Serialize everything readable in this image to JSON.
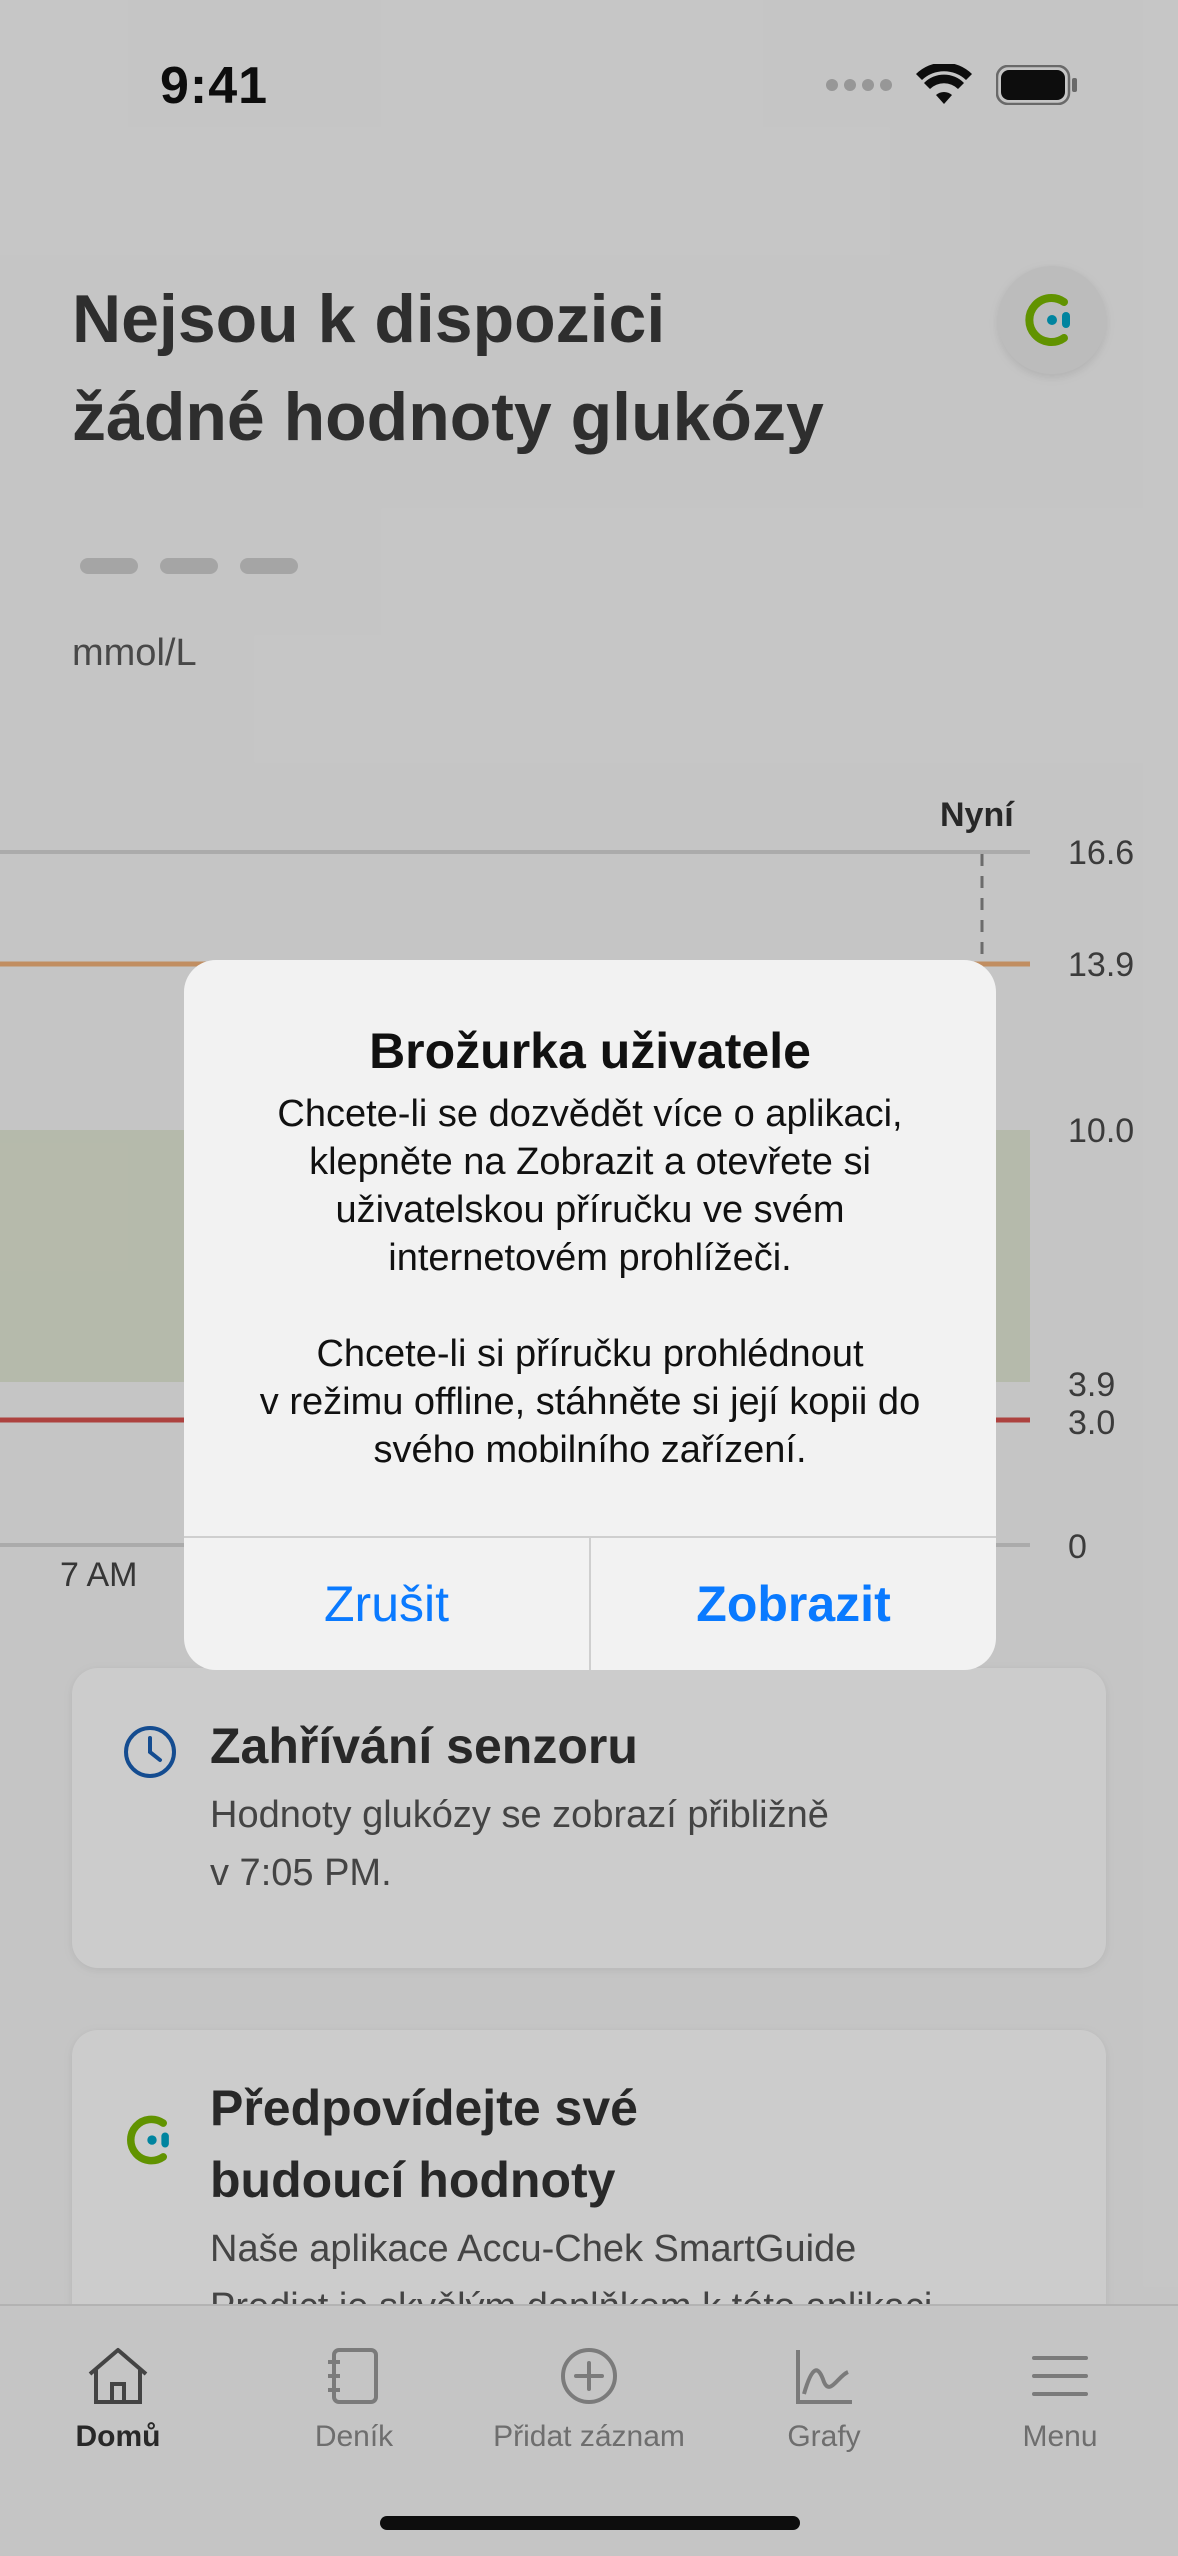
{
  "status_bar": {
    "time": "9:41"
  },
  "header": {
    "title_line1": "Nejsou k dispozici",
    "title_line2": "žádné hodnoty glukózy",
    "unit": "mmol/L"
  },
  "chart": {
    "now_label": "Nyní",
    "time_label": "7 AM",
    "y_ticks": [
      "16.6",
      "13.9",
      "10.0",
      "3.9",
      "3.0",
      "0"
    ]
  },
  "chart_data": {
    "type": "line",
    "ylabel": "mmol/L",
    "y_ticks": [
      16.6,
      13.9,
      10.0,
      3.9,
      3.0,
      0
    ],
    "target_range": [
      3.9,
      10.0
    ],
    "high_threshold": 13.9,
    "low_threshold": 3.0,
    "x_ticks": [
      "7 AM"
    ],
    "now_marker": "Nyní",
    "series": []
  },
  "cards": [
    {
      "title": "Zahřívání senzoru",
      "text_line1": "Hodnoty glukózy se zobrazí přibližně",
      "text_line2": "v 7:05 PM.",
      "icon": "clock-icon"
    },
    {
      "title_line1": "Předpovídejte své",
      "title_line2": "budoucí hodnoty",
      "text_line1": "Naše aplikace Accu-Chek SmartGuide",
      "text_line2": "Predict je skvělým doplňkem k této aplikaci",
      "icon": "smartguide-logo-icon"
    }
  ],
  "tabs": [
    {
      "label": "Domů",
      "icon": "home-icon",
      "active": true
    },
    {
      "label": "Deník",
      "icon": "logbook-icon"
    },
    {
      "label": "Přidat záznam",
      "icon": "add-circle-icon"
    },
    {
      "label": "Grafy",
      "icon": "graph-icon"
    },
    {
      "label": "Menu",
      "icon": "menu-icon"
    }
  ],
  "alert": {
    "title": "Brožurka uživatele",
    "message": "Chcete-li se dozvědět více o aplikaci,\nklepněte na Zobrazit a otevřete si\nuživatelskou příručku ve svém\ninternetovém prohlížeči.\n\nChcete-li si příručku prohlédnout\nv režimu offline, stáhněte si její kopii do\nsvého mobilního zařízení.",
    "cancel_label": "Zrušit",
    "confirm_label": "Zobrazit"
  },
  "colors": {
    "accent_blue": "#0a7aff",
    "high_line": "#f2b27a",
    "low_line": "#d9534f",
    "target_band": "#e3e9d6",
    "logo_green": "#7ab800",
    "logo_teal": "#00a6c7"
  }
}
